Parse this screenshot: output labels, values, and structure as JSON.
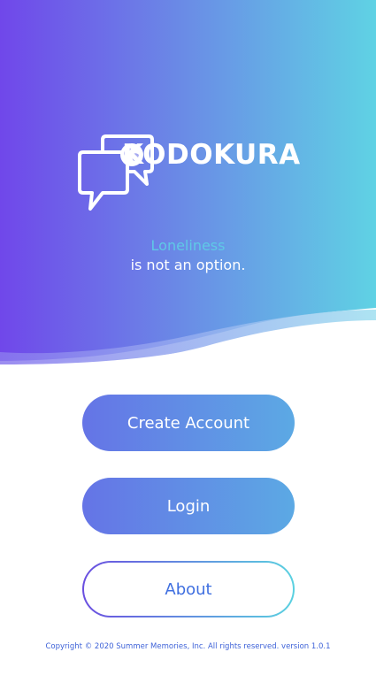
{
  "brand": {
    "name": "KODOKURA",
    "colors": {
      "gradient_start": "#7047ea",
      "gradient_end": "#5fd2e4",
      "tagline_accent": "#5fc9e6",
      "button_start": "#6574e6",
      "button_end": "#5ca9e4",
      "outline_text": "#3f6fe0",
      "footer_text": "#3f63d8"
    },
    "icons": [
      "speech-bubbles-icon",
      "globe-icon"
    ]
  },
  "tagline": {
    "line1": "Loneliness",
    "line2": "is not an option."
  },
  "buttons": {
    "create_account": "Create Account",
    "login": "Login",
    "about": "About"
  },
  "footer": {
    "copyright": "Copyright © 2020 Summer Memories, Inc. All rights reserved. version 1.0.1"
  }
}
